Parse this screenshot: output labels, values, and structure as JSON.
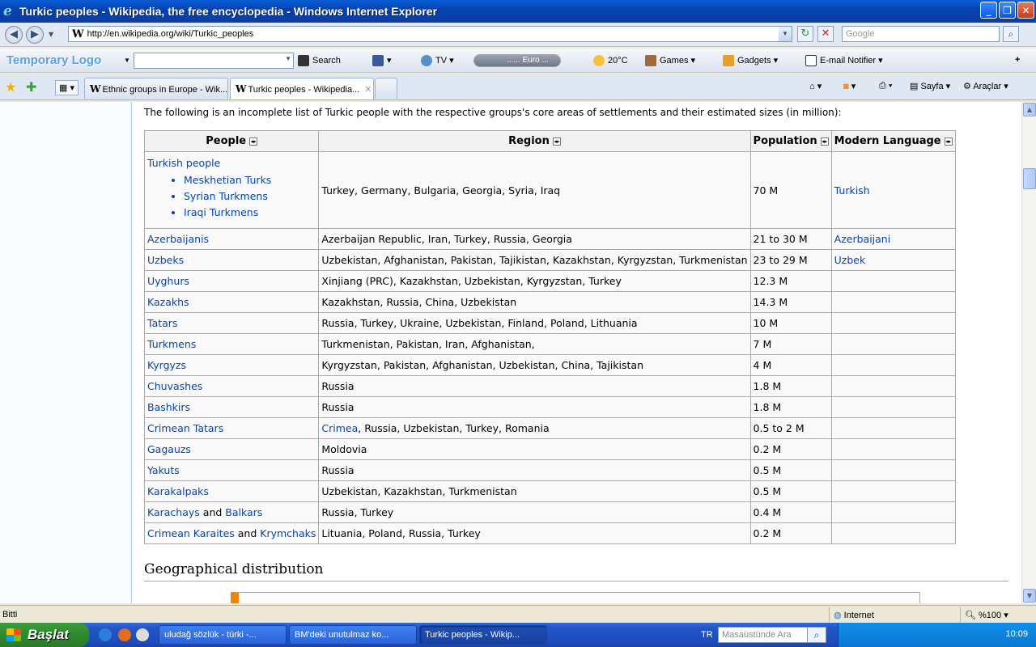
{
  "window": {
    "title": "Turkic peoples - Wikipedia, the free encyclopedia - Windows Internet Explorer"
  },
  "address": {
    "url": "http://en.wikipedia.org/wiki/Turkic_peoples",
    "search_placeholder": "Google"
  },
  "toolbar": {
    "logo": "Temporary Logo",
    "search_label": "Search",
    "tv_label": "TV",
    "euro_label": "...... Euro ...",
    "weather": "20°C",
    "games_label": "Games",
    "gadgets_label": "Gadgets",
    "email_label": "E-mail Notifier"
  },
  "tabs": [
    {
      "label": "Ethnic groups in Europe - Wik..."
    },
    {
      "label": "Turkic peoples - Wikipedia..."
    }
  ],
  "tab_tools": {
    "page_label": "Sayfa",
    "tools_label": "Araçlar"
  },
  "article": {
    "intro": "The following is an incomplete list of Turkic people with the respective groups's core areas of settlements and their estimated sizes (in million):",
    "headers": [
      "People",
      "Region",
      "Population",
      "Modern Language"
    ],
    "first_row": {
      "people": "Turkish people",
      "sub": [
        "Meskhetian Turks",
        "Syrian Turkmens",
        "Iraqi Turkmens"
      ],
      "region": "Turkey, Germany, Bulgaria, Georgia, Syria, Iraq",
      "population": "70 M",
      "language": "Turkish"
    },
    "rows": [
      {
        "people": "Azerbaijanis",
        "region": "Azerbaijan Republic, Iran, Turkey, Russia, Georgia",
        "population": "21 to 30 M",
        "language": "Azerbaijani"
      },
      {
        "people": "Uzbeks",
        "region": "Uzbekistan, Afghanistan, Pakistan, Tajikistan, Kazakhstan, Kyrgyzstan, Turkmenistan",
        "population": "23 to 29 M",
        "language": "Uzbek"
      },
      {
        "people": "Uyghurs",
        "region": "Xinjiang (PRC), Kazakhstan, Uzbekistan, Kyrgyzstan, Turkey",
        "population": "12.3 M",
        "language": ""
      },
      {
        "people": "Kazakhs",
        "region": "Kazakhstan, Russia, China, Uzbekistan",
        "population": "14.3 M",
        "language": ""
      },
      {
        "people": "Tatars",
        "region": "Russia, Turkey, Ukraine, Uzbekistan, Finland, Poland, Lithuania",
        "population": "10 M",
        "language": ""
      },
      {
        "people": "Turkmens",
        "region": "Turkmenistan, Pakistan, Iran, Afghanistan,",
        "population": "7 M",
        "language": ""
      },
      {
        "people": "Kyrgyzs",
        "region": "Kyrgyzstan, Pakistan, Afghanistan, Uzbekistan, China, Tajikistan",
        "population": "4 M",
        "language": ""
      },
      {
        "people": "Chuvashes",
        "region": "Russia",
        "population": "1.8 M",
        "language": ""
      },
      {
        "people": "Bashkirs",
        "region": "Russia",
        "population": "1.8 M",
        "language": ""
      },
      {
        "people": "Crimean Tatars",
        "region": "Crimea, Russia, Uzbekistan, Turkey, Romania",
        "population": "0.5 to 2 M",
        "language": ""
      },
      {
        "people": "Gagauzs",
        "region": "Moldovia",
        "population": "0.2 M",
        "language": ""
      },
      {
        "people": "Yakuts",
        "region": "Russia",
        "population": "0.5 M",
        "language": ""
      },
      {
        "people": "Karakalpaks",
        "region": "Uzbekistan, Kazakhstan, Turkmenistan",
        "population": "0.5 M",
        "language": ""
      },
      {
        "people": "Karachays and Balkars",
        "region": "Russia, Turkey",
        "population": "0.4 M",
        "language": ""
      },
      {
        "people": "Crimean Karaites and Krymchaks",
        "region": "Lituania, Poland, Russia, Turkey",
        "population": "0.2 M",
        "language": ""
      }
    ],
    "section_heading": "Geographical distribution"
  },
  "status": {
    "text": "Bitti",
    "zone": "Internet",
    "zoom": "%100"
  },
  "taskbar": {
    "start": "Başlat",
    "tasks": [
      "uludağ sözlük - türki -...",
      "BM'deki unutulmaz ko...",
      "Turkic peoples - Wikip..."
    ],
    "lang": "TR",
    "desk_search": "Masaüstünde Ara",
    "clock": "10:09"
  },
  "colors": {
    "link": "#0645ad",
    "title_bar": "#0a5fd8",
    "taskbar": "#2456c6",
    "start": "#2f8a2f"
  }
}
